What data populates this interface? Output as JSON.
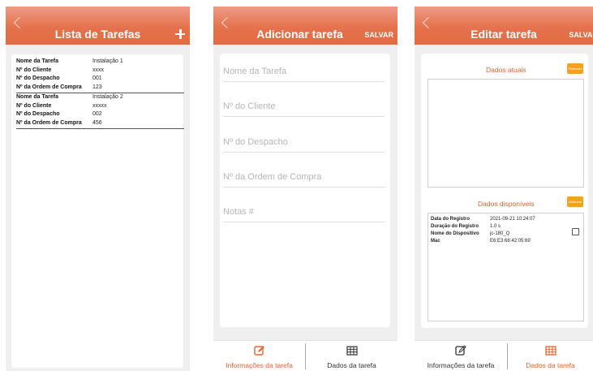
{
  "screen1": {
    "title": "Lista de Tarefas",
    "labels": {
      "name": "Nome da Tarefa",
      "client": "Nº do Cliente",
      "dispatch": "Nº do Despacho",
      "order": "Nº da Ordem de Compra"
    },
    "tasks": [
      {
        "name": "Instalação 1",
        "client": "xxxx",
        "dispatch": "001",
        "order": "123"
      },
      {
        "name": "Instalação  2",
        "client": "xxxxx",
        "dispatch": "002",
        "order": "456"
      }
    ]
  },
  "screen2": {
    "title": "Adicionar tarefa",
    "save": "SALVAR",
    "fields": {
      "name": "Nome da Tarefa",
      "client": "Nº do Cliente",
      "dispatch": "Nº do Despacho",
      "order": "Nº da Ordem de Compra",
      "notes": "Notas #"
    },
    "tabs": {
      "info": "Informações da tarefa",
      "data": "Dados da tarefa"
    }
  },
  "screen3": {
    "title": "Editar tarefa",
    "save": "SALVAR",
    "current": {
      "title": "Dados atuais",
      "button": "Remover"
    },
    "available": {
      "title": "Dados disponíveis",
      "button": "Adicionar",
      "labels": {
        "date": "Data do Registro",
        "duration": "Duração do Registro",
        "device": "Nome do Dispositivo",
        "mac": "Mac"
      },
      "record": {
        "date": "2021-09-21 10:24:07",
        "duration": "1.0 s",
        "device": "jc-180_Q",
        "mac": "E6:E3:68:42:05:69"
      }
    },
    "tabs": {
      "info": "Informações da tarefa",
      "data": "Dados da tarefa"
    }
  },
  "colors": {
    "accent": "#e5724d",
    "accent_text": "#e5642f",
    "button": "#f3a21f"
  },
  "icons": {
    "edit": "edit-icon",
    "table": "table-icon",
    "back": "chevron-left-icon",
    "add": "plus-icon"
  }
}
